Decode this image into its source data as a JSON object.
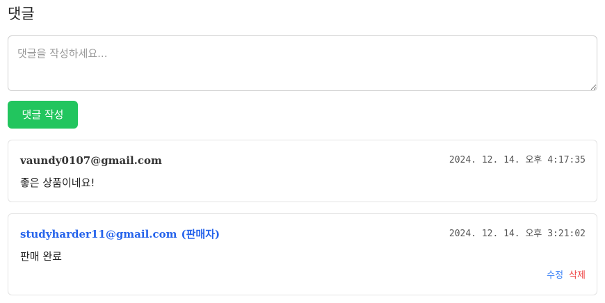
{
  "section": {
    "title": "댓글"
  },
  "comment_form": {
    "placeholder": "댓글을 작성하세요...",
    "value": "",
    "submit_label": "댓글 작성",
    "submit_color": "#22c55e"
  },
  "comments": [
    {
      "author": "vaundy0107@gmail.com",
      "seller_tag": "",
      "timestamp": "2024. 12. 14. 오후 4:17:35",
      "content": "좋은 상품이네요!"
    },
    {
      "author": "studyharder11@gmail.com",
      "seller_tag": "(판매자)",
      "timestamp": "2024. 12. 14. 오후 3:21:02",
      "content": "판매 완료",
      "edit_label": "수정",
      "delete_label": "삭제"
    }
  ],
  "colors": {
    "seller_author": "#2563eb",
    "edit": "#3b82f6",
    "delete": "#ef4444"
  }
}
